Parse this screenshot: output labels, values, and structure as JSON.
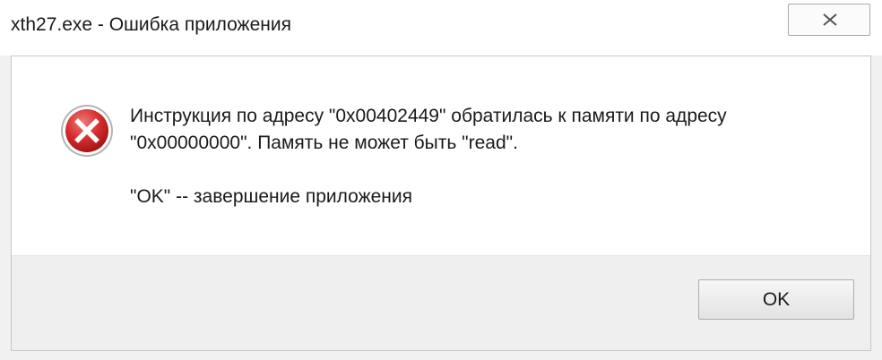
{
  "window": {
    "title": "xth27.exe - Ошибка приложения",
    "close_icon": "close-icon"
  },
  "dialog": {
    "icon": "error-icon",
    "message_line1": "Инструкция по адресу \"0x00402449\" обратилась к памяти по адресу",
    "message_line2": "\"0x00000000\". Память не может быть \"read\".",
    "message_line3": "\"OK\" -- завершение приложения"
  },
  "buttons": {
    "ok_label": "OK"
  },
  "colors": {
    "error_red": "#d23131",
    "background": "#ffffff",
    "footer": "#efefef"
  }
}
